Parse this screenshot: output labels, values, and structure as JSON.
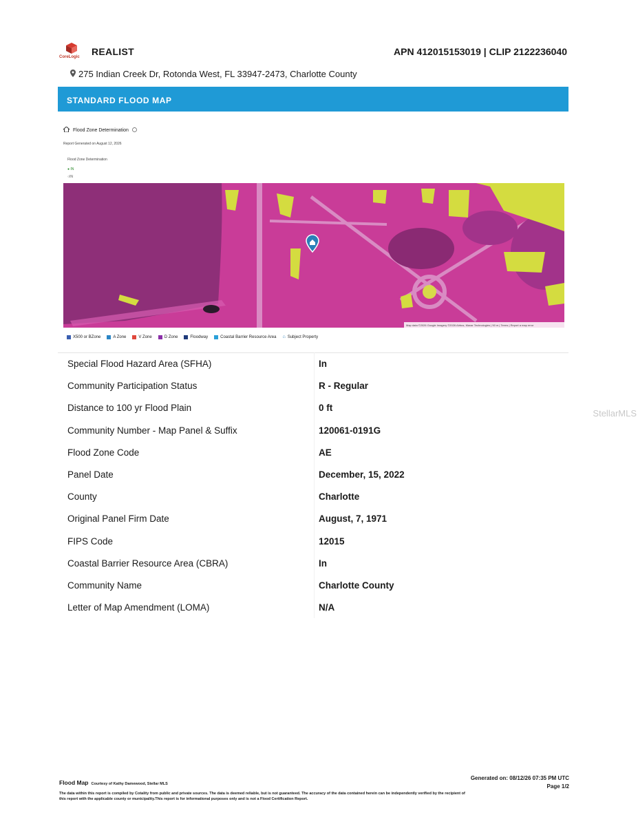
{
  "header": {
    "brand": "REALIST",
    "brand_sub": "CoreLogic",
    "apn": "APN 412015153019 | CLIP 2122236040",
    "address": "275 Indian Creek Dr, Rotonda West, FL 33947-2473, Charlotte County"
  },
  "banner": {
    "title": "STANDARD FLOOD MAP"
  },
  "map_section": {
    "heading": "Flood Zone Determination",
    "report_generated": "Report Generated on August 12, 2026",
    "sub_label": "Flood Zone Determination",
    "in_badge": "IN",
    "in_plain": "IN",
    "attribution": "Map data ©2026 Google Imagery ©2026 Airbus, Maxar Technologies | 50 m | Terms | Report a map error",
    "legend": [
      {
        "label": "X500 or BZone",
        "color": "#3a5fb0"
      },
      {
        "label": "A Zone",
        "color": "#2b86c6"
      },
      {
        "label": "V Zone",
        "color": "#e0483c"
      },
      {
        "label": "D Zone",
        "color": "#8b2fa8"
      },
      {
        "label": "Floodway",
        "color": "#1f3b7a"
      },
      {
        "label": "Coastal Barrier Resource Area",
        "color": "#2aa0d8"
      },
      {
        "label": "Subject Property",
        "color": "#2a7fb8"
      }
    ]
  },
  "table": {
    "rows": [
      {
        "label": "Special Flood Hazard Area (SFHA)",
        "value": "In"
      },
      {
        "label": "Community Participation Status",
        "value": "R - Regular"
      },
      {
        "label": "Distance to 100 yr Flood Plain",
        "value": "0 ft"
      },
      {
        "label": "Community Number - Map Panel & Suffix",
        "value": "120061-0191G"
      },
      {
        "label": "Flood Zone Code",
        "value": "AE"
      },
      {
        "label": "Panel Date",
        "value": "December, 15, 2022"
      },
      {
        "label": "County",
        "value": "Charlotte"
      },
      {
        "label": "Original Panel Firm Date",
        "value": "August, 7, 1971"
      },
      {
        "label": "FIPS Code",
        "value": "12015"
      },
      {
        "label": "Coastal Barrier Resource Area (CBRA)",
        "value": "In"
      },
      {
        "label": "Community Name",
        "value": "Charlotte County"
      },
      {
        "label": "Letter of Map Amendment (LOMA)",
        "value": "N/A"
      }
    ]
  },
  "watermark": "StellarMLS",
  "footer": {
    "title": "Flood Map",
    "courtesy": "Courtesy of Kathy Damewood, Stellar MLS",
    "disclaimer": "The data within this report is compiled by Cotality from public and private sources. The data is deemed reliable, but is not guaranteed. The accuracy of the data contained herein can be independently verified by the recipient of this report with the applicable county or municipality.This report is for informational purposes only and is not a Flood Certification Report.",
    "generated": "Generated on: 08/12/26 07:35 PM UTC",
    "page": "Page 1/2"
  }
}
